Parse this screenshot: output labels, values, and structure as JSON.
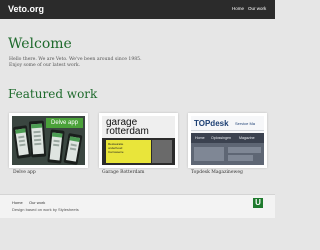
{
  "header": {
    "logo": "Veto.org",
    "nav": [
      "Home",
      "Our work"
    ]
  },
  "main": {
    "title": "Welcome",
    "intro": [
      "Hello there. We are Veto. We've been around since 1985.",
      "Enjoy some of our latest work."
    ],
    "section_title": "Featured work",
    "works": [
      {
        "caption": "Delve app",
        "thumb_text": [
          "Delve app"
        ]
      },
      {
        "caption": "Garage Rotterdam",
        "thumb_text": [
          "garage",
          "rotterdam",
          "Restauratie",
          "onderhoud",
          "Carrosserie"
        ]
      },
      {
        "caption": "Topdesk Magazineweg",
        "thumb_text": [
          "TOPdesk",
          "Service Ma",
          "Home",
          "Oplossingen",
          "Magazine"
        ]
      }
    ]
  },
  "footer": {
    "nav": [
      "Home",
      "Our work"
    ],
    "credit": "Design based on work by Stylesheets",
    "badge_icon": "U"
  },
  "colors": {
    "accent_green": "#1e6a2c",
    "topbar": "#2b2b2b",
    "background": "#e6e6e6"
  }
}
